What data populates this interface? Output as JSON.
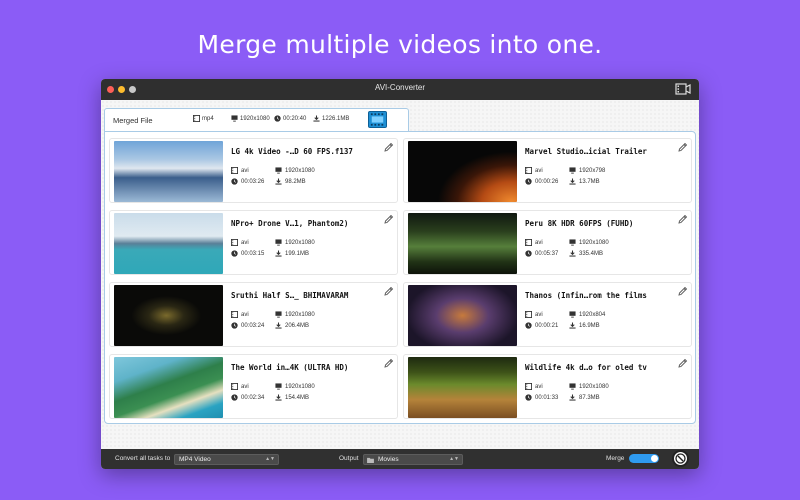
{
  "headline": "Merge multiple videos into one.",
  "window": {
    "title": "AVI-Converter"
  },
  "merged": {
    "label": "Merged File",
    "format": "mp4",
    "resolution": "1920x1080",
    "duration": "00:20:40",
    "size": "1226.1MB"
  },
  "videos": [
    {
      "title": "LG 4k Video -…D 60 FPS.f137",
      "format": "avi",
      "resolution": "1920x1080",
      "duration": "00:03:26",
      "size": "98.2MB",
      "thumb_colors": [
        "#6fa4d8",
        "#dfe7ef",
        "#3b5e8b"
      ]
    },
    {
      "title": "Marvel Studio…icial Trailer",
      "format": "avi",
      "resolution": "1920x798",
      "duration": "00:00:26",
      "size": "13.7MB",
      "thumb_colors": [
        "#070707",
        "#d2661f",
        "#3a1608"
      ]
    },
    {
      "title": "NPro+ Drone V…1, Phantom2)",
      "format": "avi",
      "resolution": "1920x1080",
      "duration": "00:03:15",
      "size": "199.1MB",
      "thumb_colors": [
        "#c9dcea",
        "#5a7f98",
        "#2fa8b8"
      ]
    },
    {
      "title": "Peru 8K HDR 60FPS (FUHD)",
      "format": "avi",
      "resolution": "1920x1080",
      "duration": "00:05:37",
      "size": "335.4MB",
      "thumb_colors": [
        "#101810",
        "#567f3b",
        "#213316"
      ]
    },
    {
      "title": "Sruthi Half S…_ BHIMAVARAM",
      "format": "avi",
      "resolution": "1920x1080",
      "duration": "00:03:24",
      "size": "206.4MB",
      "thumb_colors": [
        "#090909",
        "#1a1a12",
        "#c2a24a"
      ]
    },
    {
      "title": "Thanos (Infin…rom the films",
      "format": "avi",
      "resolution": "1920x804",
      "duration": "00:00:21",
      "size": "16.9MB",
      "thumb_colors": [
        "#1c1529",
        "#5a3d6e",
        "#c77a3c"
      ]
    },
    {
      "title": "The World in…4K (ULTRA HD)",
      "format": "avi",
      "resolution": "1920x1080",
      "duration": "00:02:34",
      "size": "154.4MB",
      "thumb_colors": [
        "#7fc7dc",
        "#2e7f4a",
        "#e6e0c0"
      ]
    },
    {
      "title": "Wildlife 4k d…o for oled tv",
      "format": "avi",
      "resolution": "1920x1080",
      "duration": "00:01:33",
      "size": "87.3MB",
      "thumb_colors": [
        "#1e2a10",
        "#6b8a2c",
        "#b5833a"
      ]
    }
  ],
  "bottom": {
    "convert_label": "Convert all tasks to",
    "convert_value": "MP4 Video",
    "output_label": "Output",
    "output_value": "Movies",
    "merge_label": "Merge",
    "merge_on": true
  },
  "colors": {
    "background": "#8b5cf6",
    "accent": "#2f9bf0",
    "panel_border": "#a9cbe6"
  }
}
